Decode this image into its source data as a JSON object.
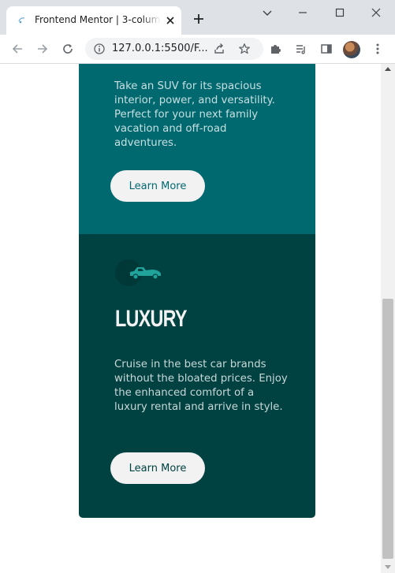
{
  "browser": {
    "tab_title": "Frontend Mentor | 3-column preview card component",
    "url": "127.0.0.1:5500/F..."
  },
  "cards": {
    "suv": {
      "description": "Take an SUV for its spacious interior, power, and versatility. Perfect for your next family vacation and off-road adventures.",
      "button_label": "Learn More",
      "background": "#006970"
    },
    "luxury": {
      "icon": "luxury-car-icon",
      "title": "LUXURY",
      "description": "Cruise in the best car brands without the bloated prices. Enjoy the enhanced comfort of a luxury rental and arrive in style.",
      "button_label": "Learn More",
      "background": "#004241"
    }
  },
  "colors": {
    "accent_suv": "#006970",
    "accent_luxury": "#004241",
    "button_bg": "#f2f2f2"
  }
}
